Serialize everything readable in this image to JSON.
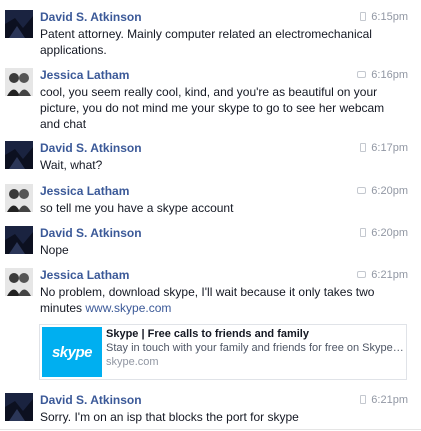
{
  "messages": [
    {
      "sender": "David S. Atkinson",
      "time": "6:15pm",
      "text": "Patent attorney. Mainly computer related an electromechanical applications."
    },
    {
      "sender": "Jessica Latham",
      "time": "6:16pm",
      "text": "cool, you seem really cool, kind, and you're as beautiful on  your picture, you do not mind me your skype to go to see her webcam and chat"
    },
    {
      "sender": "David S. Atkinson",
      "time": "6:17pm",
      "text": "Wait, what?"
    },
    {
      "sender": "Jessica Latham",
      "time": "6:20pm",
      "text": "so tell me you have a skype account"
    },
    {
      "sender": "David S. Atkinson",
      "time": "6:20pm",
      "text": "Nope"
    },
    {
      "sender": "Jessica Latham",
      "time": "6:21pm",
      "text": "No problem, download skype, I'll wait because it only takes two minutes ",
      "link": "www.skype.com"
    },
    {
      "sender": "David S. Atkinson",
      "time": "6:21pm",
      "text": "Sorry. I'm on an isp that blocks the port for skype"
    }
  ],
  "link_preview": {
    "logo_text": "skype",
    "title": "Skype | Free calls to friends and family",
    "description": "Stay in touch with your family and friends for free on Skype. Down...",
    "domain": "skype.com"
  }
}
